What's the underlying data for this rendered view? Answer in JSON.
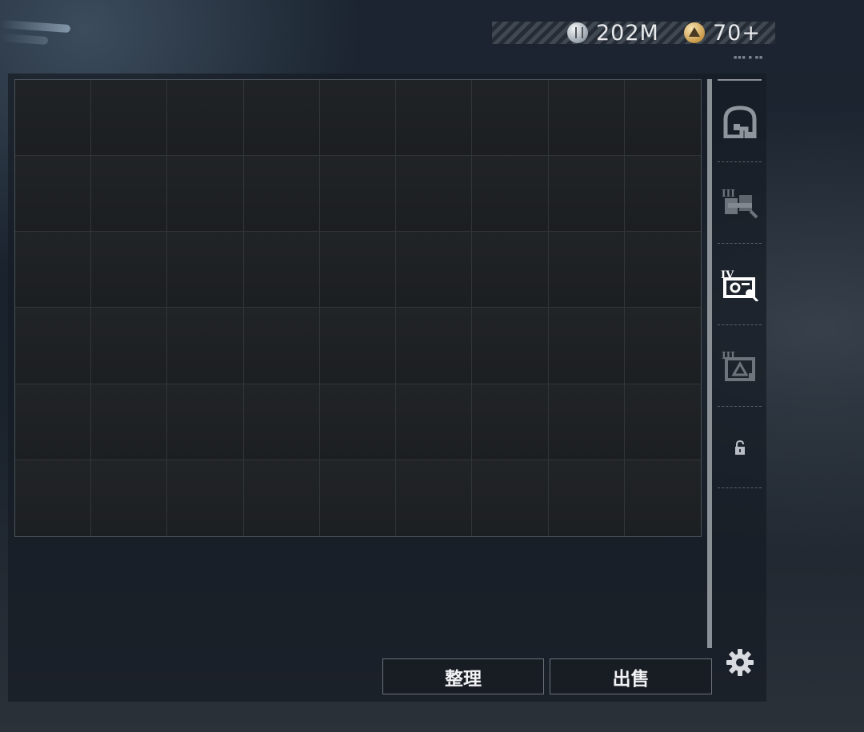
{
  "currencies": {
    "silver": {
      "icon": "silver-coin-icon",
      "value": "202M"
    },
    "gold": {
      "icon": "gold-coin-icon",
      "value": "70+"
    }
  },
  "header": {
    "caption": "■■■ ■ ■■"
  },
  "inventory": {
    "columns": 9,
    "rows": 6,
    "occupied_slots": 0
  },
  "side_tabs": [
    {
      "icon": "backpack-icon",
      "state": "normal"
    },
    {
      "icon": "tier-iii-chest-rig-icon",
      "tier": "III",
      "state": "dimmed"
    },
    {
      "icon": "tier-iv-key-case-icon",
      "tier": "IV",
      "state": "selected"
    },
    {
      "icon": "tier-iii-container-icon",
      "tier": "III",
      "state": "dimmed"
    },
    {
      "icon": "lock-icon",
      "state": "locked"
    }
  ],
  "buttons": {
    "sort_label": "整理",
    "sell_label": "出售",
    "settings_icon": "gear-icon"
  },
  "colors": {
    "panel_border": "#4a5058",
    "text": "#e8eaec",
    "gold_coin": "#c99a4a",
    "silver_coin": "#9aa3ac"
  }
}
